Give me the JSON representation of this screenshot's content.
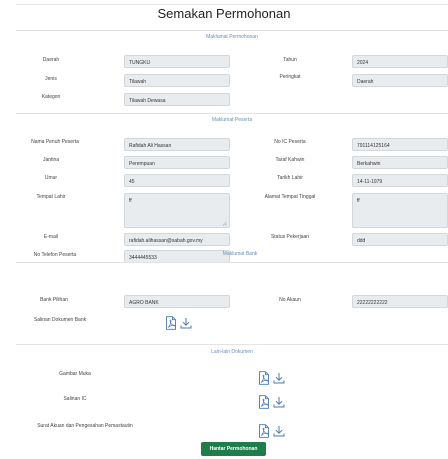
{
  "page": {
    "title": "Semakan Permohonan",
    "submit_label": "Hantar Permohonan"
  },
  "colors": {
    "accent": "#6a8fb8",
    "button": "#1e7e4a",
    "icon": "#4a79b0",
    "input_bg": "#e9ecef"
  },
  "sections": {
    "permohonan": "Maklumat Permohonan",
    "peserta": "Maklumat Peserta",
    "bank": "Maklumat Bank",
    "dokumen": "Lain-lain Dokumen"
  },
  "permohonan": {
    "daerah_label": "Daerah",
    "daerah": "TUNGKU",
    "tahun_label": "Tahun",
    "tahun": "2024",
    "jenis_label": "Jenis",
    "jenis": "Tilawah",
    "peringkat_label": "Peringkat",
    "peringkat": "Daerah",
    "kategori_label": "Kategori",
    "kategori": "Tilawah Dewasa"
  },
  "peserta": {
    "nama_label": "Nama Penuh Peserta",
    "nama": "Rafidah Ali Hassan",
    "ic_label": "No IC Peserta",
    "ic": "791114125164",
    "jantina_label": "Jantina",
    "jantina": "Perempuan",
    "kahwin_label": "Taraf Kahwin",
    "kahwin": "Berkahwin",
    "umur_label": "Umur",
    "umur": "45",
    "lahir_label": "Tarikh Lahir",
    "lahir": "14-11-1979",
    "tempat_lahir_label": "Tempat Lahir",
    "tempat_lahir": "ff",
    "alamat_label": "Alamat Tempat Tinggal",
    "alamat": "ff",
    "email_label": "E-mail",
    "email": "rafidah.alihassan@sabah.gov.my",
    "pekerjaan_label": "Status Pekerjaan",
    "pekerjaan": "ddd",
    "telefon_label": "No Telefon Peserta",
    "telefon": "3444445533"
  },
  "bank": {
    "bank_label": "Bank Pilihan",
    "bank": "AGRO BANK",
    "akaun_label": "No Akaun",
    "akaun": "22222222222",
    "salinan_label": "Salinan Dokumen Bank"
  },
  "dokumen": {
    "gambar_label": "Gambar Muka",
    "ic_label": "Salinan IC",
    "akuan_label": "Surat Akuan dan Pengesahan Pemastautin"
  }
}
